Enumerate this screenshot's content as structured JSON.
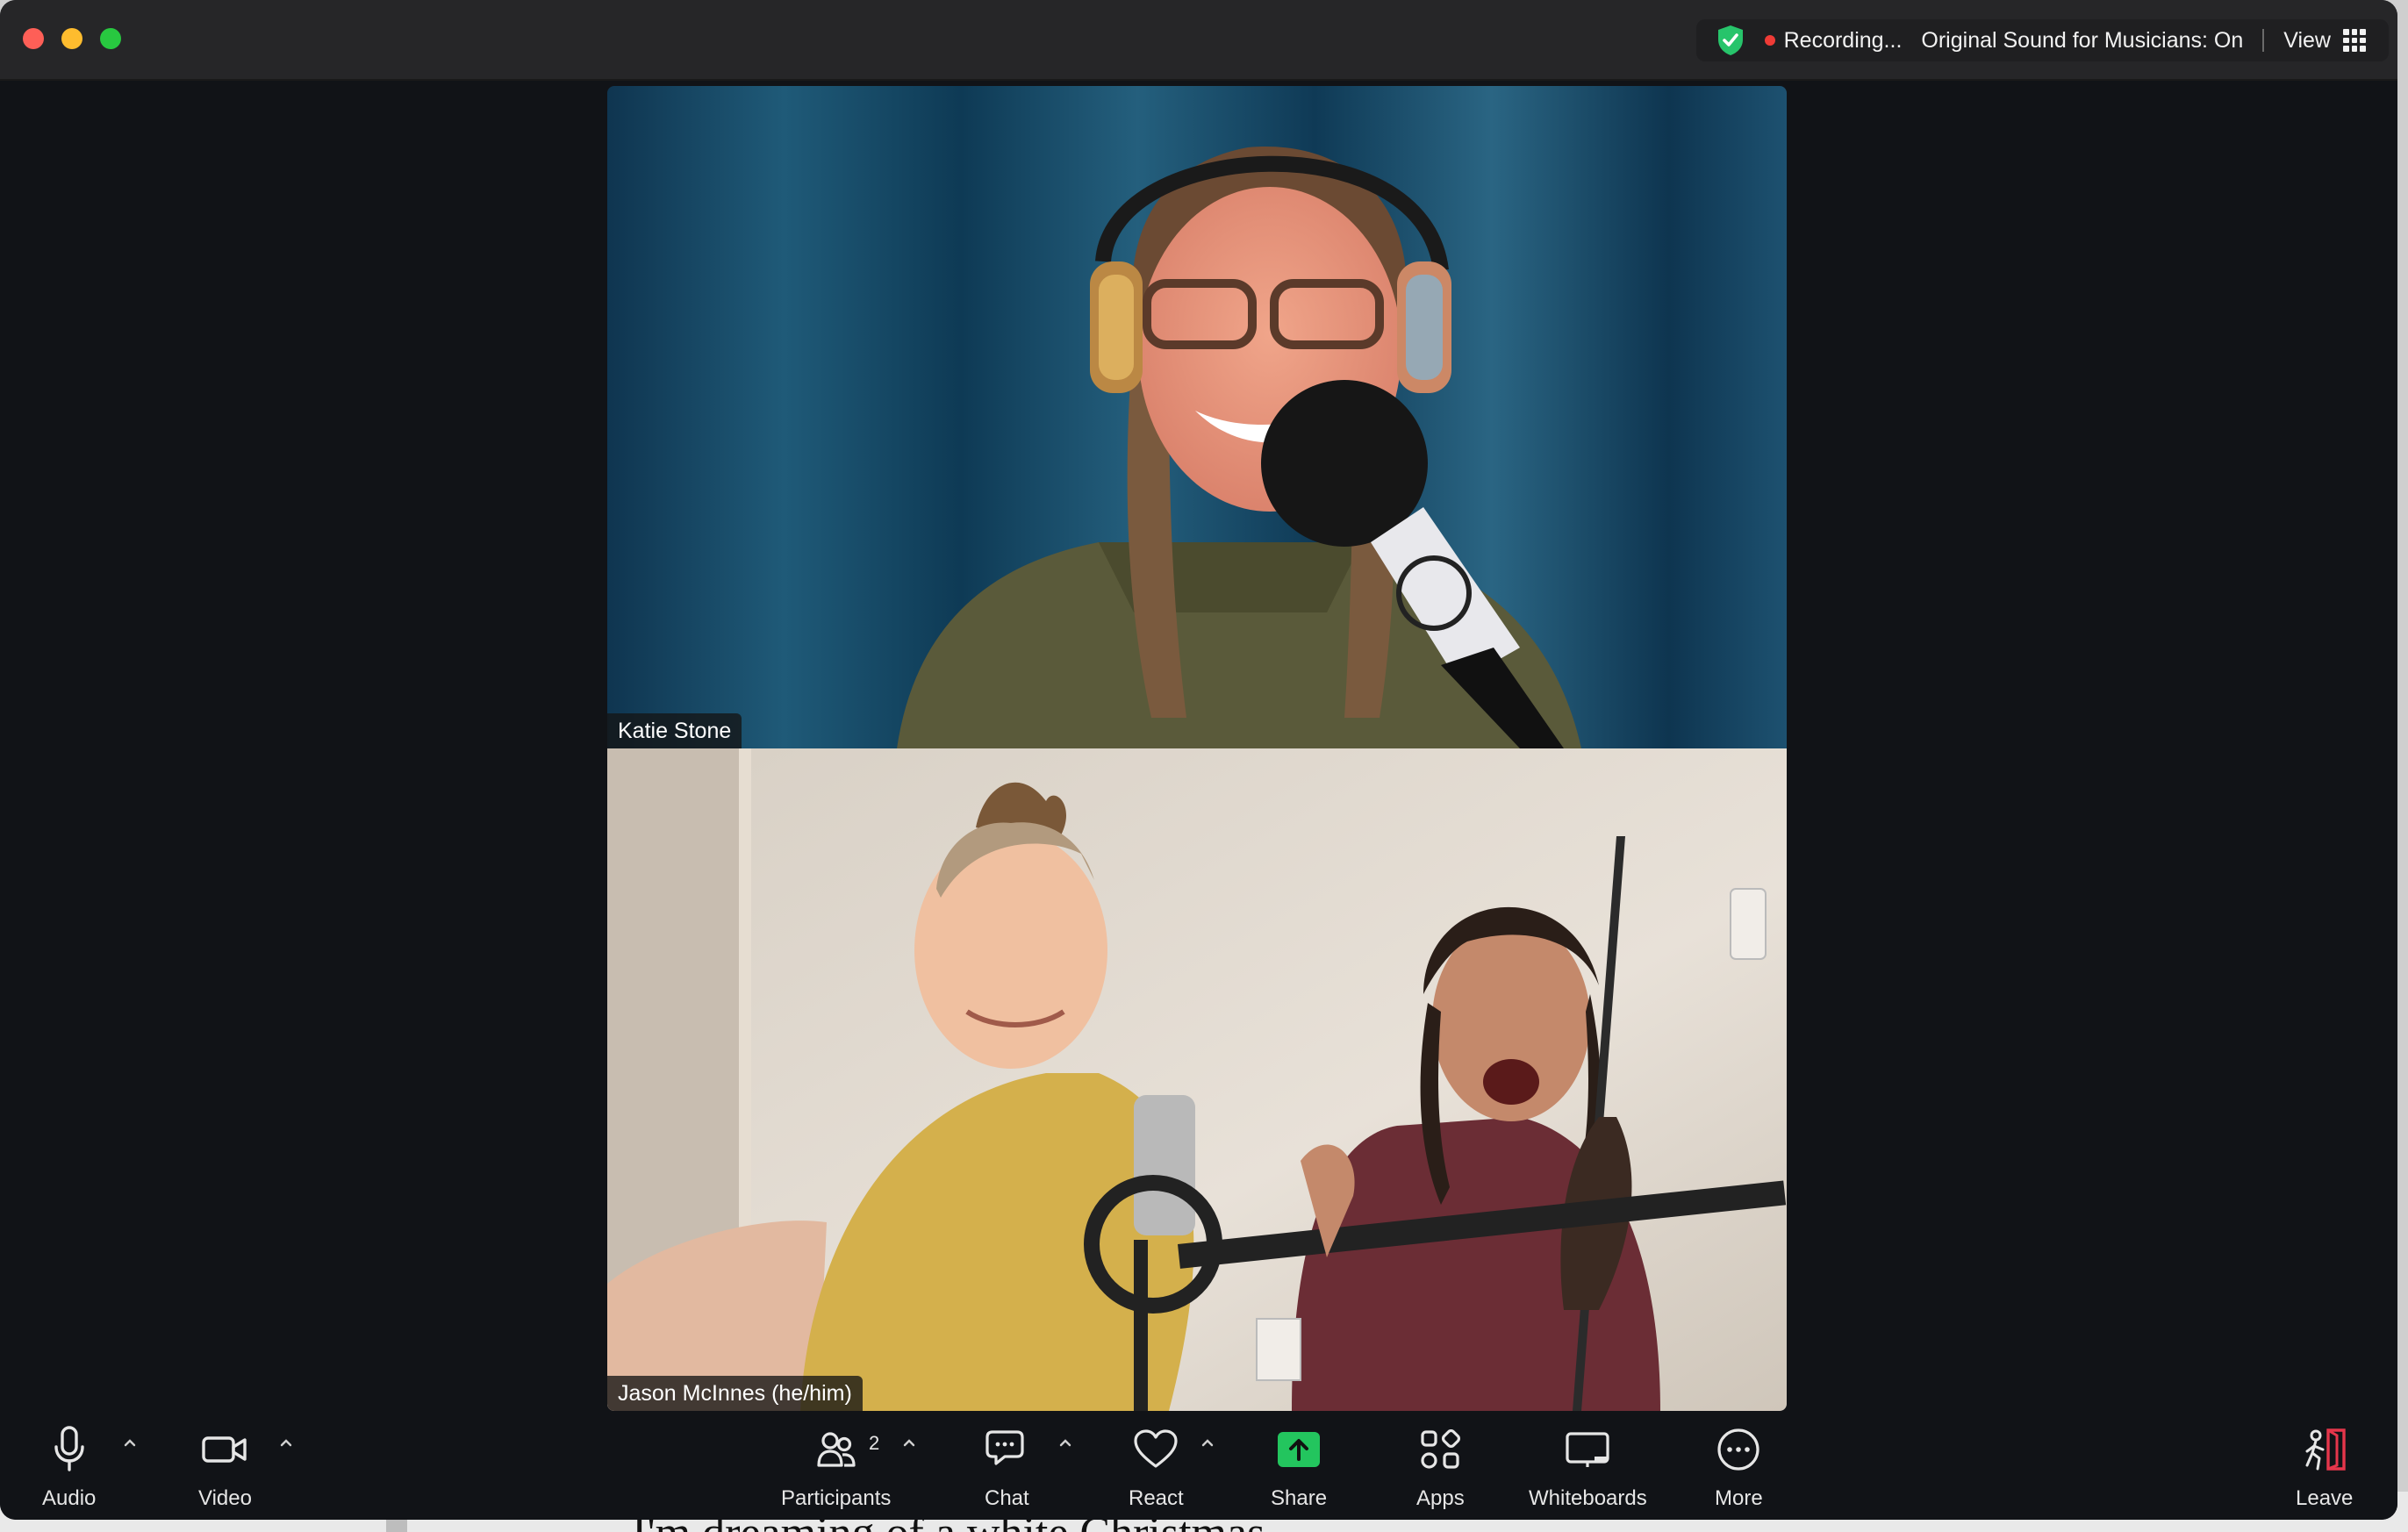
{
  "titlebar": {
    "recording": "Recording...",
    "original_sound": "Original Sound for Musicians: On",
    "view": "View",
    "security_icon": "shield-check-icon",
    "view_icon": "grid-icon"
  },
  "participants_video": [
    {
      "name": "Katie Stone"
    },
    {
      "name": "Jason McInnes (he/him)"
    }
  ],
  "toolbar": {
    "audio": "Audio",
    "video": "Video",
    "participants": "Participants",
    "participants_count": "2",
    "chat": "Chat",
    "react": "React",
    "share": "Share",
    "apps": "Apps",
    "whiteboards": "Whiteboards",
    "more": "More",
    "leave": "Leave"
  },
  "background_document": {
    "text": "I'm dreaming of a white Christmas"
  },
  "colors": {
    "window_bg": "#111317",
    "titlebar_bg": "#262628",
    "share_green": "#23c55e",
    "record_red": "#ef3b36",
    "leave_red": "#e5364b"
  }
}
